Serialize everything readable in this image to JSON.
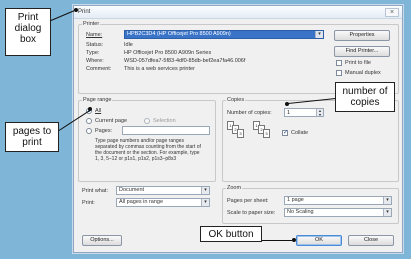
{
  "dialog": {
    "title": "Print",
    "close_glyph": "×",
    "printer": {
      "group_label": "Printer",
      "name_label": "Name:",
      "name_value": "HPB2C3D4 (HP Officejet Pro 8500 A909n)",
      "status_label": "Status:",
      "status_value": "Idle",
      "type_label": "Type:",
      "type_value": "HP Officejet Pro 8500 A909n Series",
      "where_label": "Where:",
      "where_value": "WSD-057dfea7-5f83-4df0-85db-bef2ea7fa46.006f",
      "comment_label": "Comment:",
      "comment_value": "This is a web services printer",
      "properties_label": "Properties",
      "find_printer_label": "Find Printer...",
      "print_to_file_label": "Print to file",
      "manual_duplex_label": "Manual duplex"
    },
    "page_range": {
      "group_label": "Page range",
      "all_label": "All",
      "current_page_label": "Current page",
      "selection_label": "Selection",
      "pages_label": "Pages:",
      "description": "Type page numbers and/or page ranges separated by commas counting from the start of the document or the section. For example, type 1, 3, 5–12 or p1s1, p1s2, p1s3–p8s3"
    },
    "copies": {
      "group_label": "Copies",
      "number_label": "Number of copies:",
      "number_value": "1",
      "collate_label": "Collate"
    },
    "print_what": {
      "label": "Print what:",
      "value": "Document"
    },
    "print": {
      "label": "Print:",
      "value": "All pages in range"
    },
    "zoom": {
      "group_label": "Zoom",
      "pages_per_sheet_label": "Pages per sheet:",
      "pages_per_sheet_value": "1 page",
      "scale_label": "Scale to paper size:",
      "scale_value": "No Scaling"
    },
    "options_label": "Options...",
    "ok_label": "OK",
    "close_label": "Close",
    "arrow_glyph": "▾"
  },
  "callouts": {
    "print_dialog": "Print dialog box",
    "number_of_copies": "number of copies",
    "pages_to_print": "pages to print",
    "ok_button": "OK button"
  },
  "colors": {
    "background": "#7fb6d8",
    "selected_printer": "#3a74c8"
  }
}
